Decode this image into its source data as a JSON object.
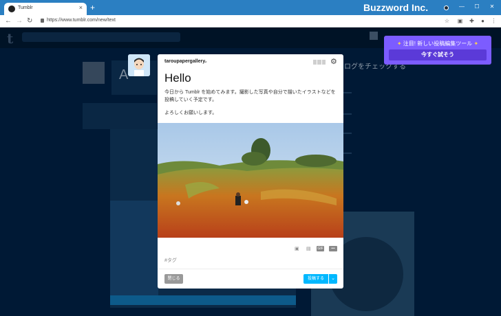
{
  "browser": {
    "tab_title": "Tumblr",
    "tab_close": "×",
    "new_tab": "+",
    "brand": "Buzzword Inc.",
    "url": "https://www.tumblr.com/new/text",
    "back": "←",
    "forward": "→",
    "reload": "↻",
    "minimize": "—",
    "maximize": "☐",
    "close": "✕"
  },
  "background": {
    "logo": "t",
    "text_a": "A",
    "text_blog_customize": "ログをチェックする"
  },
  "editor": {
    "blog_name": "taroupapergallery",
    "blog_chevron": "⌄",
    "title": "Hello",
    "body_line1": "今日から Tumblr を始めてみます。撮影した写真や自分で描いたイラストなどを",
    "body_line2": "投稿していく予定です。",
    "body_line3": "よろしくお願いします。",
    "tools": {
      "gif": "GIF",
      "more": "•••"
    },
    "tag_placeholder": "#タグ",
    "close_label": "閉じる",
    "post_label": "投稿する",
    "post_arrow": "⌄"
  },
  "promo": {
    "star_left": "✦",
    "star_right": "✦",
    "text": "注目! 新しい投稿編集ツール",
    "button": "今すぐ試そう"
  },
  "colors": {
    "accent_blue": "#00b8ff",
    "promo_purple": "#7c5cff",
    "titlebar": "#2b7fc2"
  }
}
